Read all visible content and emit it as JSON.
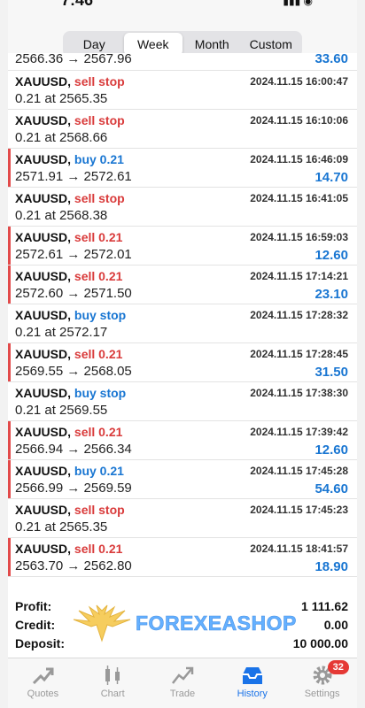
{
  "statusbar": {
    "time": "7:46",
    "signal": "▮▮▮ ◉"
  },
  "period_tabs": [
    {
      "label": "Day",
      "active": false
    },
    {
      "label": "Week",
      "active": true
    },
    {
      "label": "Month",
      "active": false
    },
    {
      "label": "Custom",
      "active": false
    }
  ],
  "top_partial": {
    "line2": "2566.36 → 2567.96",
    "pnl": "33.60"
  },
  "rows": [
    {
      "symbol": "XAUUSD,",
      "action": "sell stop",
      "side": "sell",
      "datetime": "2024.11.15 16:00:47",
      "line2": "0.21 at 2565.35",
      "pnl": "",
      "marker": false
    },
    {
      "symbol": "XAUUSD,",
      "action": "sell stop",
      "side": "sell",
      "datetime": "2024.11.15 16:10:06",
      "line2": "0.21 at 2568.66",
      "pnl": "",
      "marker": false
    },
    {
      "symbol": "XAUUSD,",
      "action": "buy 0.21",
      "side": "buy",
      "datetime": "2024.11.15 16:46:09",
      "line2": "2571.91 → 2572.61",
      "pnl": "14.70",
      "marker": true
    },
    {
      "symbol": "XAUUSD,",
      "action": "sell stop",
      "side": "sell",
      "datetime": "2024.11.15 16:41:05",
      "line2": "0.21 at 2568.38",
      "pnl": "",
      "marker": false
    },
    {
      "symbol": "XAUUSD,",
      "action": "sell 0.21",
      "side": "sell",
      "datetime": "2024.11.15 16:59:03",
      "line2": "2572.61 → 2572.01",
      "pnl": "12.60",
      "marker": true
    },
    {
      "symbol": "XAUUSD,",
      "action": "sell 0.21",
      "side": "sell",
      "datetime": "2024.11.15 17:14:21",
      "line2": "2572.60 → 2571.50",
      "pnl": "23.10",
      "marker": true
    },
    {
      "symbol": "XAUUSD,",
      "action": "buy stop",
      "side": "buy",
      "datetime": "2024.11.15 17:28:32",
      "line2": "0.21 at 2572.17",
      "pnl": "",
      "marker": false
    },
    {
      "symbol": "XAUUSD,",
      "action": "sell 0.21",
      "side": "sell",
      "datetime": "2024.11.15 17:28:45",
      "line2": "2569.55 → 2568.05",
      "pnl": "31.50",
      "marker": true
    },
    {
      "symbol": "XAUUSD,",
      "action": "buy stop",
      "side": "buy",
      "datetime": "2024.11.15 17:38:30",
      "line2": "0.21 at 2569.55",
      "pnl": "",
      "marker": false
    },
    {
      "symbol": "XAUUSD,",
      "action": "sell 0.21",
      "side": "sell",
      "datetime": "2024.11.15 17:39:42",
      "line2": "2566.94 → 2566.34",
      "pnl": "12.60",
      "marker": true
    },
    {
      "symbol": "XAUUSD,",
      "action": "buy 0.21",
      "side": "buy",
      "datetime": "2024.11.15 17:45:28",
      "line2": "2566.99 → 2569.59",
      "pnl": "54.60",
      "marker": true
    },
    {
      "symbol": "XAUUSD,",
      "action": "sell stop",
      "side": "sell",
      "datetime": "2024.11.15 17:45:23",
      "line2": "0.21 at 2565.35",
      "pnl": "",
      "marker": false
    },
    {
      "symbol": "XAUUSD,",
      "action": "sell 0.21",
      "side": "sell",
      "datetime": "2024.11.15 18:41:57",
      "line2": "2563.70 → 2562.80",
      "pnl": "18.90",
      "marker": true
    }
  ],
  "summary": {
    "profit_label": "Profit:",
    "profit_value": "1 111.62",
    "credit_label": "Credit:",
    "credit_value": "0.00",
    "deposit_label": "Deposit:",
    "deposit_value": "10 000.00"
  },
  "watermark": {
    "text": "FOREXEASHOP"
  },
  "tabbar": {
    "items": [
      {
        "label": "Quotes",
        "icon": "quotes-icon"
      },
      {
        "label": "Chart",
        "icon": "chart-icon"
      },
      {
        "label": "Trade",
        "icon": "trade-icon"
      },
      {
        "label": "History",
        "icon": "history-icon",
        "active": true
      },
      {
        "label": "Settings",
        "icon": "gear-icon"
      }
    ],
    "settings_badge": "32"
  },
  "colors": {
    "sell": "#d93b3b",
    "buy": "#1976d2",
    "profit": "#1976d2",
    "marker": "#e24a4a",
    "active_tab": "#1a73e8"
  }
}
